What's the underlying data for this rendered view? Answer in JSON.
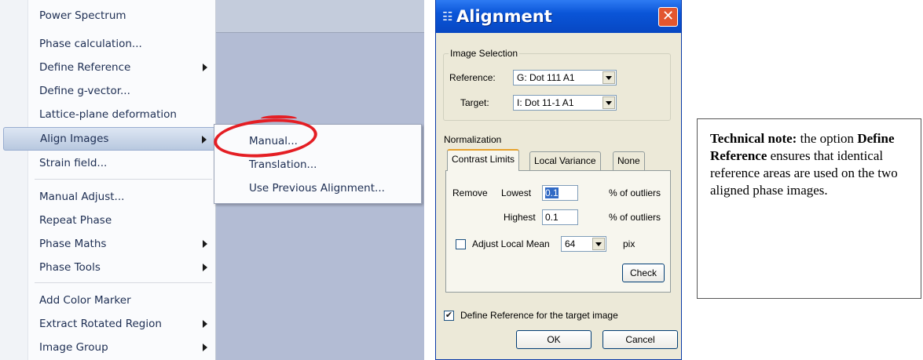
{
  "main_menu": {
    "items": [
      {
        "label": "Power Spectrum",
        "submenu": false
      },
      {
        "label": "Phase calculation...",
        "submenu": false
      },
      {
        "label": "Define Reference",
        "submenu": true
      },
      {
        "label": "Define g-vector...",
        "submenu": false
      },
      {
        "label": "Lattice-plane deformation",
        "submenu": false
      },
      {
        "label": "Align Images",
        "submenu": true,
        "active": true
      },
      {
        "label": "Strain field...",
        "submenu": false
      },
      {
        "label": "Manual Adjust...",
        "submenu": false
      },
      {
        "label": "Repeat Phase",
        "submenu": false
      },
      {
        "label": "Phase Maths",
        "submenu": true
      },
      {
        "label": "Phase Tools",
        "submenu": true
      },
      {
        "label": "Add Color Marker",
        "submenu": false
      },
      {
        "label": "Extract Rotated Region",
        "submenu": true
      },
      {
        "label": "Image Group",
        "submenu": true
      }
    ]
  },
  "align_submenu": {
    "items": [
      {
        "label": "Manual...",
        "circled": true
      },
      {
        "label": "Translation..."
      },
      {
        "label": "Use Previous Alignment..."
      }
    ]
  },
  "dialog": {
    "title": "Alignment",
    "close_icon": "close-x-icon",
    "image_selection": {
      "group_label": "Image Selection",
      "reference_label": "Reference:",
      "reference_value": "G: Dot 111 A1",
      "target_label": "Target:",
      "target_value": "I: Dot 11-1 A1"
    },
    "normalization": {
      "label": "Normalization",
      "tabs": [
        "Contrast Limits",
        "Local Variance",
        "None"
      ],
      "active_tab": "Contrast Limits",
      "remove_label": "Remove",
      "lowest_label": "Lowest",
      "lowest_value": "0.1",
      "highest_label": "Highest",
      "highest_value": "0.1",
      "outliers_unit": "% of outliers",
      "adjust_local_mean_label": "Adjust Local Mean",
      "adjust_local_mean_checked": false,
      "local_mean_value": "64",
      "pix_unit": "pix",
      "check_button": "Check"
    },
    "define_reference_label": "Define Reference for the target image",
    "define_reference_checked": true,
    "ok_button": "OK",
    "cancel_button": "Cancel"
  },
  "note": {
    "bold_prefix": "Technical note:",
    "text_1": " the option ",
    "bold_term": "Define Reference",
    "text_2": " ensures that identical reference areas are used on the two aligned phase images."
  },
  "colors": {
    "highlight_ring": "#e41e24",
    "titlebar": "#0a55d8",
    "menu_text": "#1c2d52"
  }
}
